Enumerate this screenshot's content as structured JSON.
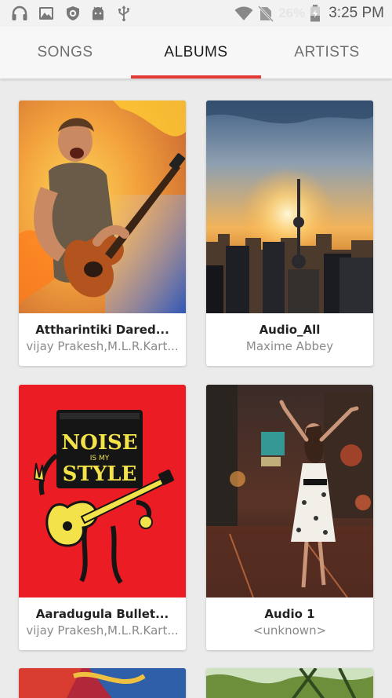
{
  "status_bar": {
    "battery_percent": "26%",
    "time": "3:25 PM",
    "icons": [
      "headphones-icon",
      "image-icon",
      "shield-icon",
      "android-icon",
      "usb-icon",
      "wifi-icon",
      "no-sim-icon",
      "battery-icon"
    ]
  },
  "tabs": [
    {
      "label": "SONGS",
      "active": false
    },
    {
      "label": "ALBUMS",
      "active": true
    },
    {
      "label": "ARTISTS",
      "active": false
    }
  ],
  "accent_color": "#e53935",
  "albums": [
    {
      "title": "Attharintiki Dared...",
      "artist": "vijay Prakesh,M.L.R.Kart..."
    },
    {
      "title": "Audio_All",
      "artist": "Maxime Abbey"
    },
    {
      "title": "Aaradugula Bullet...",
      "artist": "vijay Prakesh,M.L.R.Kart..."
    },
    {
      "title": "Audio 1",
      "artist": "<unknown>"
    }
  ],
  "album_art": {
    "noise_poster_top": "NOISE",
    "noise_poster_mid": "IS MY",
    "noise_poster_bottom": "STYLE"
  }
}
